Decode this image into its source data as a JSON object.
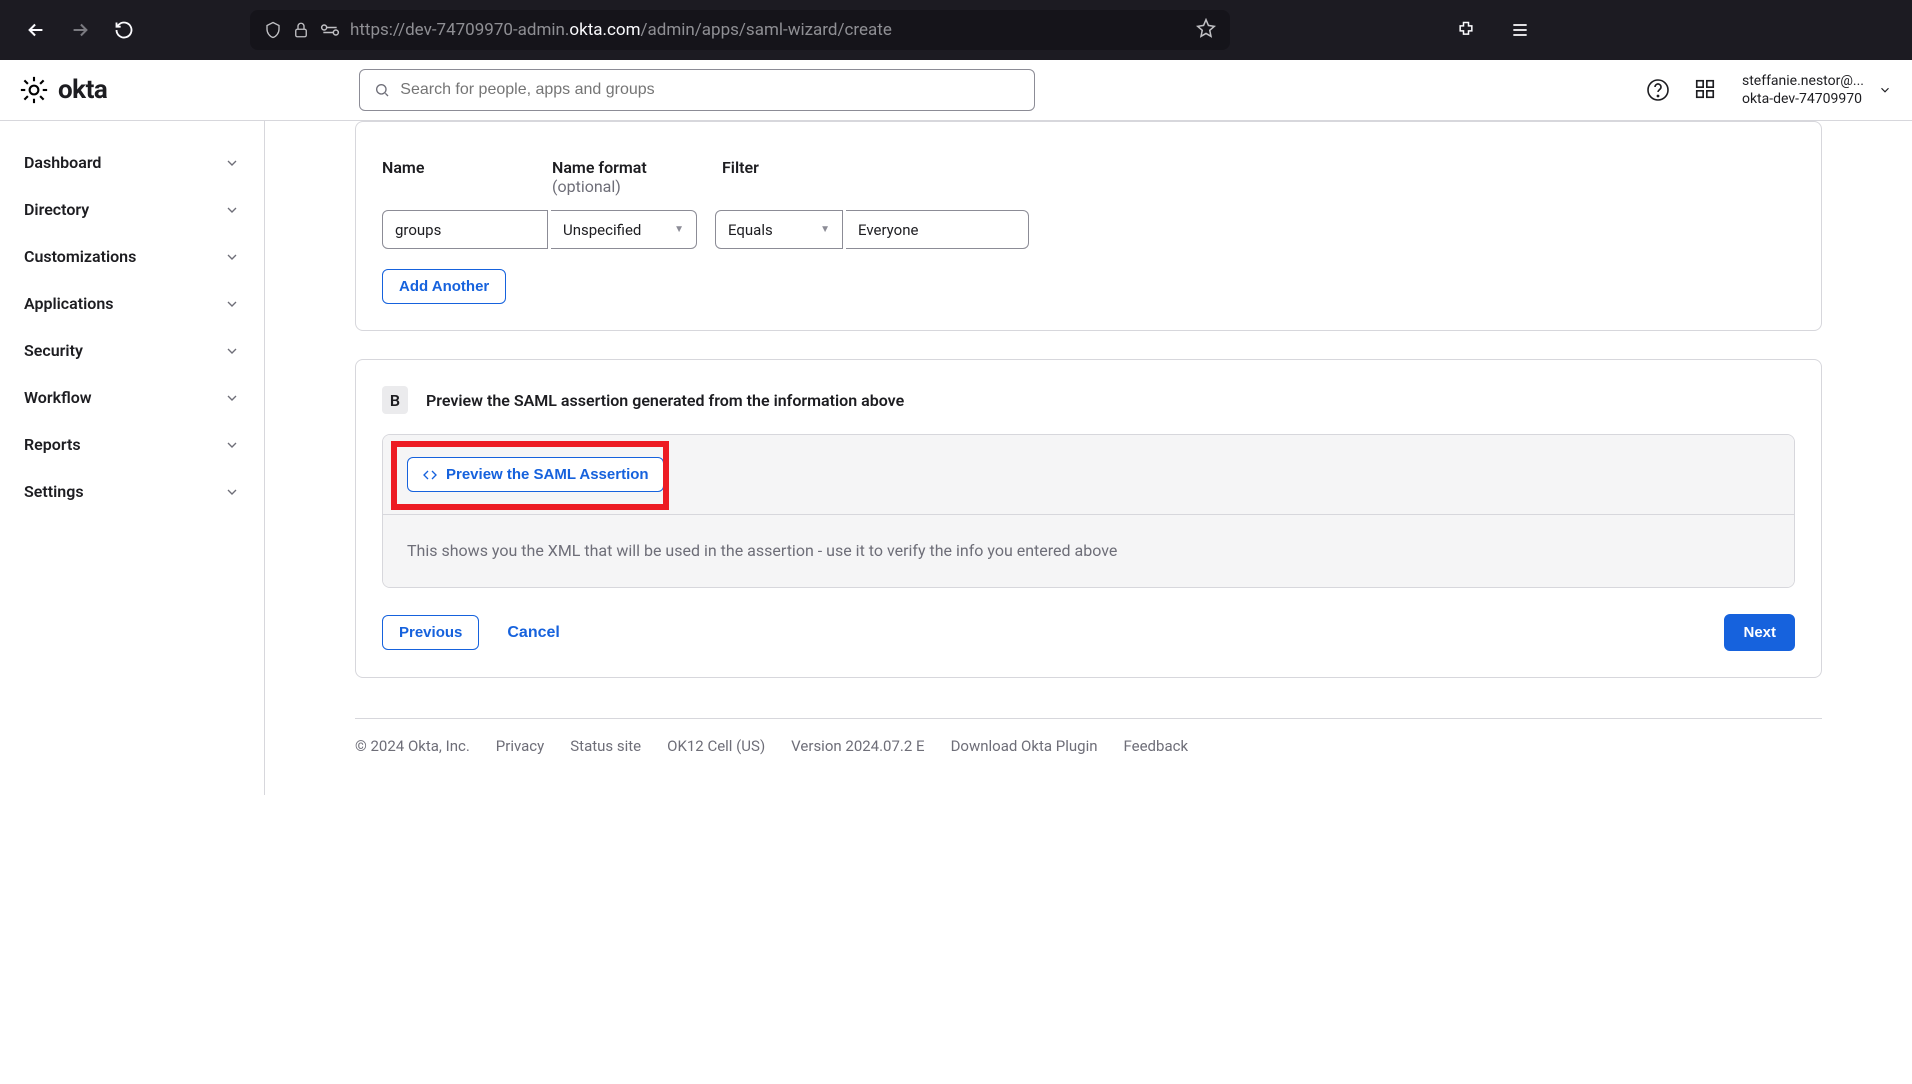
{
  "browser": {
    "url_parts": [
      "https://dev-74709970-admin.",
      "okta.com",
      "/admin/apps/saml-wizard/create"
    ]
  },
  "header": {
    "logo": "okta",
    "search_placeholder": "Search for people, apps and groups",
    "user_email": "steffanie.nestor@...",
    "user_org": "okta-dev-74709970"
  },
  "sidebar": {
    "items": [
      "Dashboard",
      "Directory",
      "Customizations",
      "Applications",
      "Security",
      "Workflow",
      "Reports",
      "Settings"
    ]
  },
  "card_a": {
    "col_name": "Name",
    "col_format": "Name format",
    "col_format_opt": "(optional)",
    "col_filter": "Filter",
    "row": {
      "name": "groups",
      "format": "Unspecified",
      "filter": "Equals",
      "value": "Everyone"
    },
    "add_another": "Add Another"
  },
  "card_b": {
    "badge": "B",
    "title": "Preview the SAML assertion generated from the information above",
    "preview_btn": "Preview the SAML Assertion",
    "desc": "This shows you the XML that will be used in the assertion - use it to verify the info you entered above"
  },
  "wizard": {
    "previous": "Previous",
    "cancel": "Cancel",
    "next": "Next"
  },
  "footer": {
    "copyright": "© 2024 Okta, Inc.",
    "links": [
      "Privacy",
      "Status site",
      "OK12 Cell (US)",
      "Version 2024.07.2 E",
      "Download Okta Plugin",
      "Feedback"
    ]
  }
}
